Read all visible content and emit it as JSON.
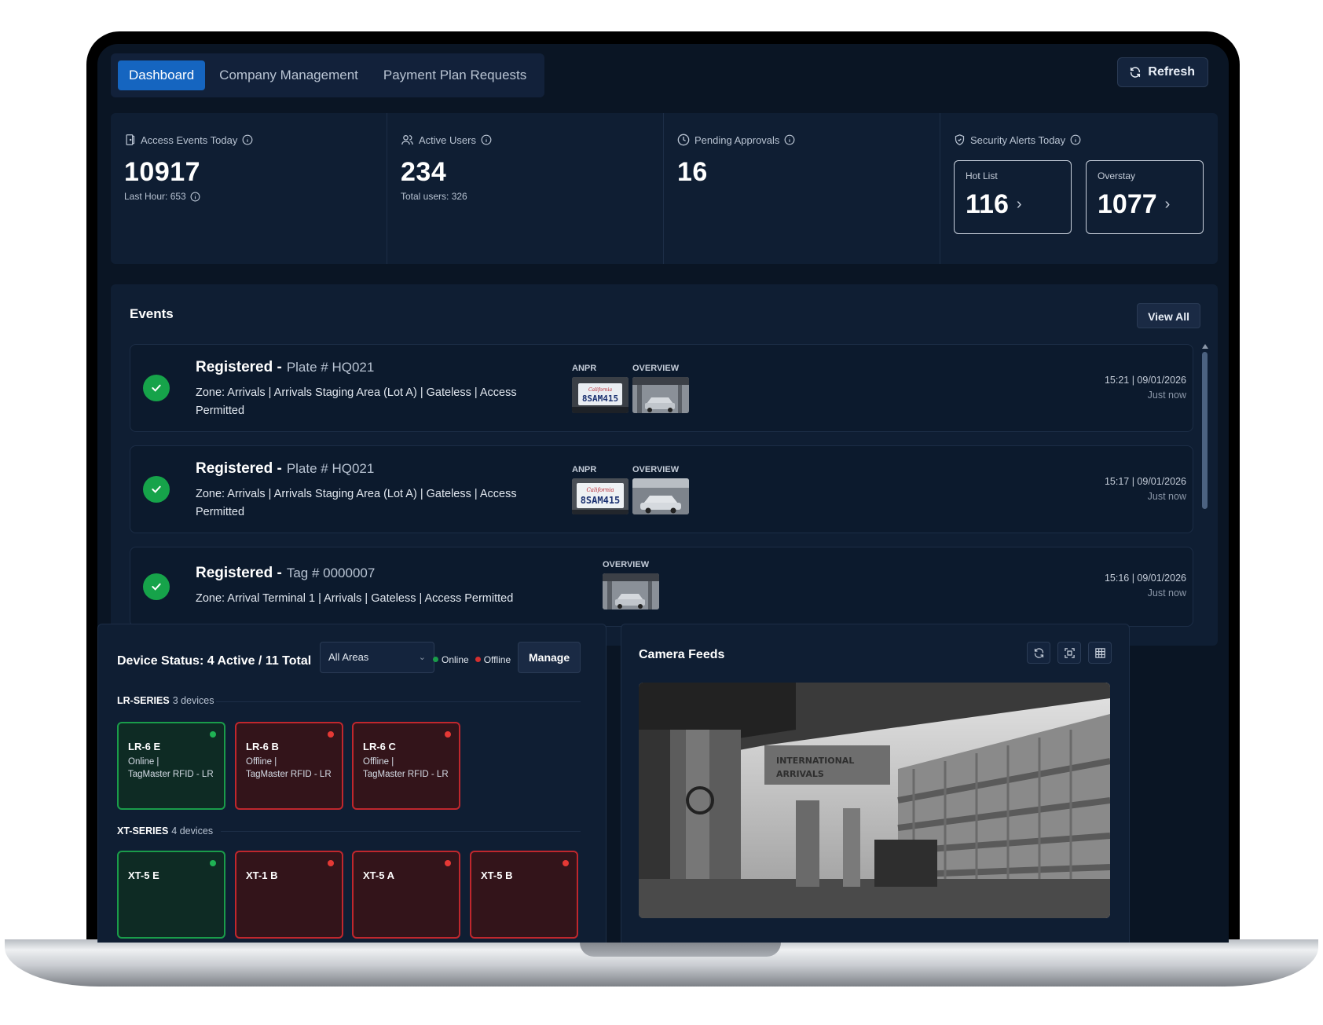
{
  "nav": {
    "tabs": [
      {
        "label": "Dashboard",
        "active": true
      },
      {
        "label": "Company Management",
        "active": false
      },
      {
        "label": "Payment Plan Requests",
        "active": false
      }
    ],
    "refresh_label": "Refresh"
  },
  "metrics": {
    "access": {
      "label": "Access Events Today",
      "value": "10917",
      "sub": "Last Hour: 653",
      "icon": "door-icon"
    },
    "users": {
      "label": "Active Users",
      "value": "234",
      "sub": "Total users: 326",
      "icon": "users-icon"
    },
    "pending": {
      "label": "Pending Approvals",
      "value": "16",
      "icon": "clock-icon"
    },
    "security": {
      "label": "Security Alerts Today",
      "icon": "shield-icon",
      "hot_list": {
        "label": "Hot List",
        "value": "116"
      },
      "overstay": {
        "label": "Overstay",
        "value": "1077"
      }
    }
  },
  "events": {
    "title": "Events",
    "view_all_label": "View All",
    "items": [
      {
        "status": "Registered",
        "id_label": "Plate # HQ021",
        "zone": "Zone: Arrivals | Arrivals Staging Area (Lot A) | Gateless | Access Permitted",
        "anpr_label": "ANPR",
        "overview_label": "OVERVIEW",
        "time": "15:21 | 09/01/2026",
        "ago": "Just now"
      },
      {
        "status": "Registered",
        "id_label": "Plate # HQ021",
        "zone": "Zone: Arrivals | Arrivals Staging Area (Lot A) | Gateless | Access Permitted",
        "anpr_label": "ANPR",
        "overview_label": "OVERVIEW",
        "time": "15:17 | 09/01/2026",
        "ago": "Just now"
      },
      {
        "status": "Registered",
        "id_label": "Tag # 0000007",
        "zone": "Zone: Arrival Terminal 1 | Arrivals | Gateless | Access Permitted",
        "overview_label": "OVERVIEW",
        "time": "15:16 | 09/01/2026",
        "ago": "Just now"
      }
    ]
  },
  "devices": {
    "title": "Device Status: 4 Active / 11 Total",
    "area_select": "All Areas",
    "legend_online": "Online",
    "legend_offline": "Offline",
    "manage_label": "Manage",
    "colors": {
      "online": "#1a9c4a",
      "offline": "#d32f2f"
    },
    "series": [
      {
        "name": "LR-SERIES",
        "count": "3 devices",
        "items": [
          {
            "name": "LR-6 E",
            "status": "Online |",
            "type": "TagMaster RFID - LR"
          },
          {
            "name": "LR-6 B",
            "status": "Offline |",
            "type": "TagMaster RFID - LR"
          },
          {
            "name": "LR-6 C",
            "status": "Offline |",
            "type": "TagMaster RFID - LR"
          }
        ]
      },
      {
        "name": "XT-SERIES",
        "count": "4 devices",
        "items": [
          {
            "name": "XT-5 E"
          },
          {
            "name": "XT-1 B"
          },
          {
            "name": "XT-5 A"
          },
          {
            "name": "XT-5 B"
          }
        ]
      }
    ]
  },
  "camera": {
    "title": "Camera Feeds",
    "feed_sign_line1": "INTERNATIONAL",
    "feed_sign_line2": "ARRIVALS"
  }
}
